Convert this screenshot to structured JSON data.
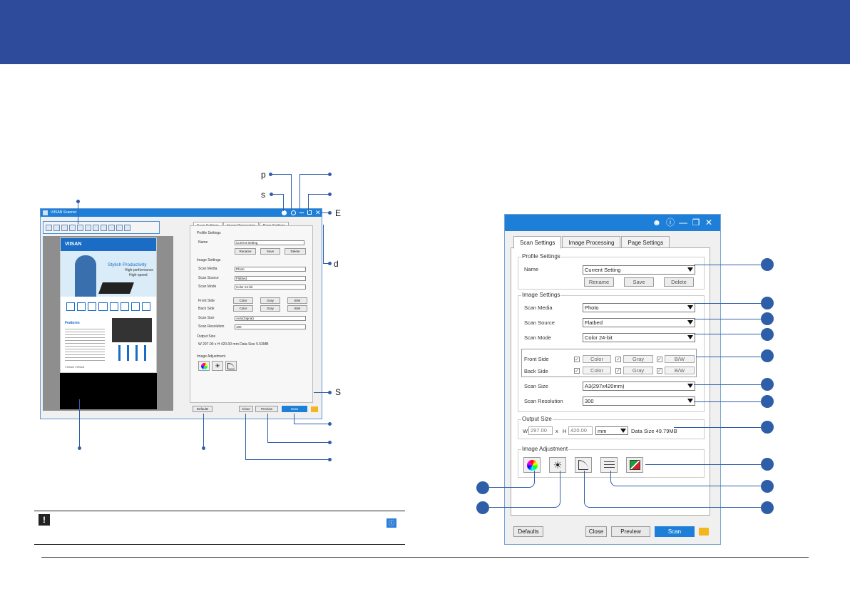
{
  "colors": {
    "banner": "#2e4a9a",
    "callout": "#2f5ea8",
    "title_bar": "#1e7fd8",
    "scan_button": "#1e7fd8"
  },
  "callout_letters": {
    "p": "p",
    "s": "s",
    "e": "E",
    "d": "d",
    "S": "S"
  },
  "small_window": {
    "title": "VIISAN Scanner",
    "tabs": [
      "Scan Settings",
      "Image Processing",
      "Page Settings"
    ],
    "preview_doc": {
      "brand": "VIISAN",
      "headline": "Stylish Productivity",
      "sub1": "High-performance",
      "sub2": "High-speed",
      "features": "Features",
      "footer": "VIISAN VIISAN"
    },
    "profile_settings": "Profile Settings",
    "name_label": "Name",
    "name_value": "Current Setting",
    "rename": "Rename",
    "save": "Save",
    "delete": "Delete",
    "image_settings": "Image Settings",
    "scan_media_label": "Scan Media",
    "scan_media": "Photo",
    "scan_source_label": "Scan Source",
    "scan_source": "Flatbed",
    "scan_mode_label": "Scan Mode",
    "scan_mode": "Color 24-bit",
    "front_side": "Front Side",
    "back_side": "Back Side",
    "color": "Color",
    "gray": "Gray",
    "bw": "B/W",
    "scan_size_label": "Scan Size",
    "scan_size": "Auto(Signal)",
    "scan_resolution_label": "Scan Resolution",
    "scan_resolution": "100",
    "output_size": "Output Size",
    "w": "W",
    "w_value": "297.00",
    "x": "x",
    "h": "H",
    "h_value": "420.00",
    "unit": "mm",
    "data_size": "Data Size 5.53MB",
    "image_adjustment": "Image Adjustment",
    "defaults": "Defaults",
    "close": "Close",
    "preview": "Preview",
    "scan": "Scan"
  },
  "big_window": {
    "tabs": [
      "Scan Settings",
      "Image Processing",
      "Page Settings"
    ],
    "profile_settings": "Profile Settings",
    "name_label": "Name",
    "name_value": "Current Setting",
    "rename": "Rename",
    "save": "Save",
    "delete": "Delete",
    "image_settings": "Image Settings",
    "scan_media_label": "Scan Media",
    "scan_media": "Photo",
    "scan_source_label": "Scan Source",
    "scan_source": "Flatbed",
    "scan_mode_label": "Scan Mode",
    "scan_mode": "Color 24-bit",
    "front_side": "Front Side",
    "back_side": "Back Side",
    "color": "Color",
    "gray": "Gray",
    "bw": "B/W",
    "scan_size_label": "Scan Size",
    "scan_size": "A3(297x420mm)",
    "scan_resolution_label": "Scan Resolution",
    "scan_resolution": "300",
    "output_size": "Output Size",
    "w": "W",
    "w_value": "297.00",
    "x": "x",
    "h": "H",
    "h_value": "420.00",
    "unit": "mm",
    "data_size": "Data Size 49.79MB",
    "image_adjustment": "Image Adjustment",
    "defaults": "Defaults",
    "close": "Close",
    "preview": "Preview",
    "scan": "Scan"
  },
  "icons": [
    "skin-icon",
    "info-icon",
    "minimize-icon",
    "restore-icon",
    "close-icon",
    "folder-icon",
    "warning-icon"
  ]
}
